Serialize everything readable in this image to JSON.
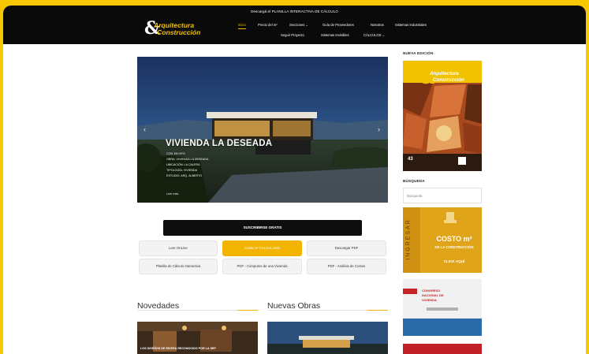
{
  "topbar": {
    "promo": "Descargá el PLANILLA INTERACTIVA DE CÁLCULO"
  },
  "logo": {
    "line1": "Arquitectura",
    "amp": "&",
    "line2": "Construcción"
  },
  "nav": {
    "row1": [
      "Inicio",
      "Precio del m²",
      "Secciones",
      "Guía de Proveedores",
      "Nosotros",
      "Sistemas Industriales"
    ],
    "row2": [
      "Seguir Proyecto",
      "Sistemas Invisibles",
      "CÁLCULOS"
    ],
    "active": "Inicio"
  },
  "hero": {
    "title": "VIVIENDA LA DESEADA",
    "details": [
      "CON 390 M²/2",
      "OBRA: VIVIENDA LA DESEADA",
      "UBICACIÓN: LA CALERA",
      "TIPOLOGÍA: VIVIENDA",
      "ESTUDIO: ARQ. ALBERTO"
    ],
    "read_more": "Leer más",
    "prev_icon": "‹",
    "next_icon": "›"
  },
  "subscribe_label": "SUSCRIBIRSE GRATIS",
  "buttons": [
    {
      "label": "Leer OnLine",
      "highlight": false
    },
    {
      "label": "Costo m² CALCULADO",
      "highlight": true
    },
    {
      "label": "Descargar PDF",
      "highlight": false
    },
    {
      "label": "Planilla de Cálculo Interactiva",
      "highlight": false
    },
    {
      "label": "PDF - Cómputos de una Vivienda",
      "highlight": false
    },
    {
      "label": "PDF - Análisis de Costos",
      "highlight": false
    }
  ],
  "sections": {
    "novedades": "Novedades",
    "nuevas_obras": "Nuevas Obras"
  },
  "thumbs": {
    "novedades_caption": "LOS DISEÑOS DE RIVERA RECONOCIDO POR LA SEP"
  },
  "sidebar": {
    "nueva_edicion": "NUEVA EDICIÓN",
    "cover_number": "43",
    "busqueda": "BÚSQUEDA",
    "search_placeholder": "Búsqueda",
    "ad_costo": {
      "ingresar": "INGRESAR",
      "title": "COSTO m²",
      "subtitle": "DE LA CONSTRUCCIÓN",
      "cta": "CLICK AQUÍ"
    },
    "ad_congreso": {
      "line1": "CONGRESO",
      "line2": "NACIONAL DE",
      "line3": "VIVIENDA"
    }
  },
  "colors": {
    "accent": "#f2b400",
    "frame": "#f7c800",
    "topbar": "#0a0a0a"
  }
}
